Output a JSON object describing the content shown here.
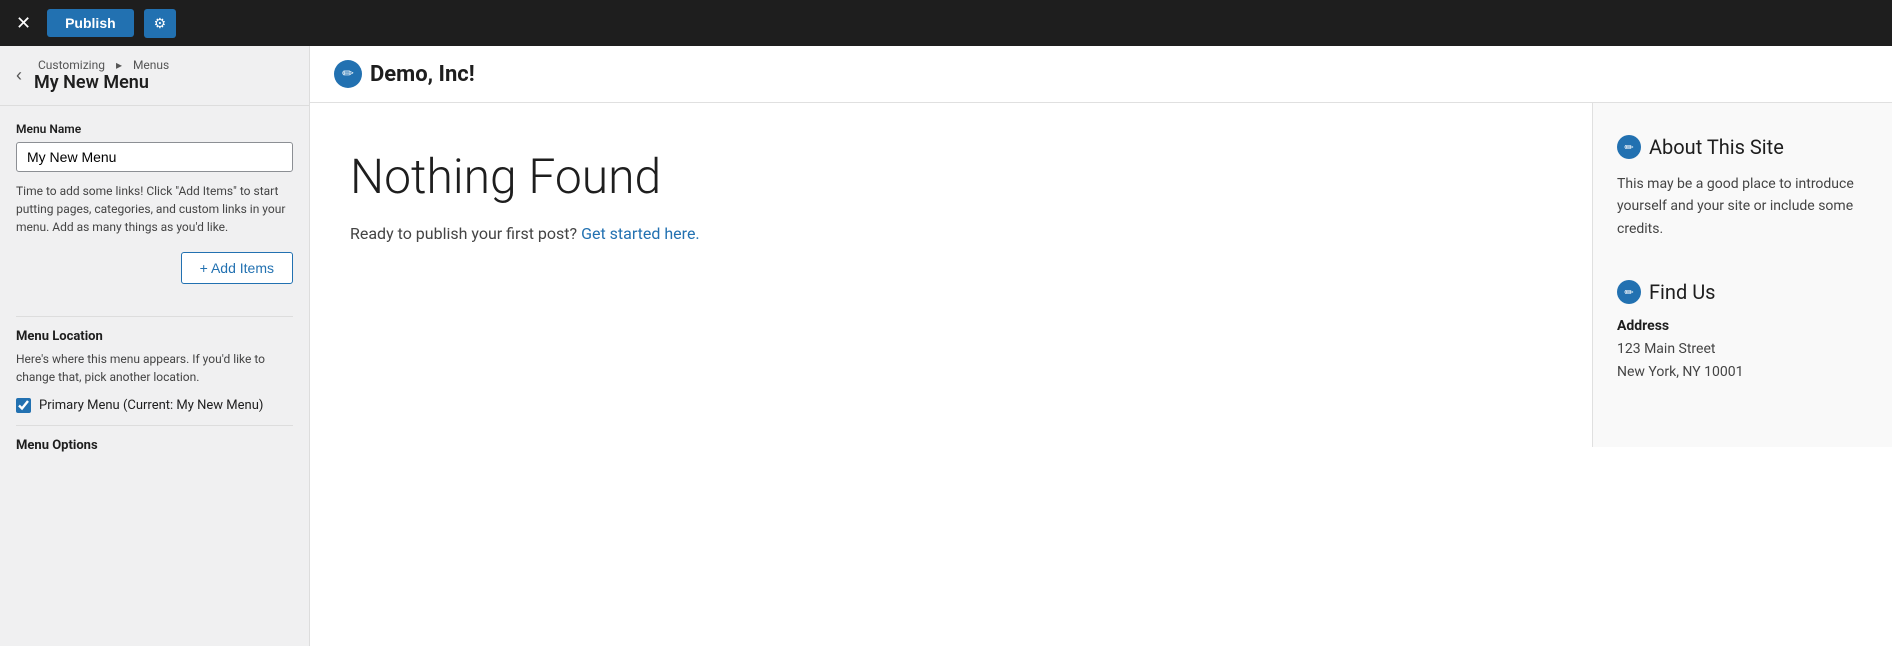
{
  "topbar": {
    "close_label": "✕",
    "publish_label": "Publish",
    "settings_icon": "⚙"
  },
  "sidebar": {
    "breadcrumb": {
      "parent": "Customizing",
      "separator": "▸",
      "current": "Menus"
    },
    "title": "My New Menu",
    "menu_name_label": "Menu Name",
    "menu_name_value": "My New Menu",
    "menu_name_placeholder": "My New Menu",
    "help_text": "Time to add some links! Click \"Add Items\" to start putting pages, categories, and custom links in your menu. Add as many things as you'd like.",
    "add_items_label": "+ Add Items",
    "menu_location_title": "Menu Location",
    "menu_location_desc": "Here's where this menu appears. If you'd like to change that, pick another location.",
    "primary_menu_label": "Primary Menu (Current: My New Menu)",
    "primary_menu_checked": true,
    "menu_options_title": "Menu Options"
  },
  "preview": {
    "site_name": "Demo, Inc!",
    "nothing_found_title": "Nothing Found",
    "nothing_found_text": "Ready to publish your first post?",
    "get_started_link": "Get started here.",
    "widgets": [
      {
        "id": "about",
        "title": "About This Site",
        "text": "This may be a good place to introduce yourself and your site or include some credits."
      },
      {
        "id": "find-us",
        "title": "Find Us",
        "address_label": "Address",
        "address_lines": [
          "123 Main Street",
          "New York, NY 10001"
        ]
      }
    ]
  },
  "icons": {
    "pencil": "✏",
    "gear": "⚙",
    "plus": "+",
    "back_arrow": "‹",
    "check": "✓"
  }
}
